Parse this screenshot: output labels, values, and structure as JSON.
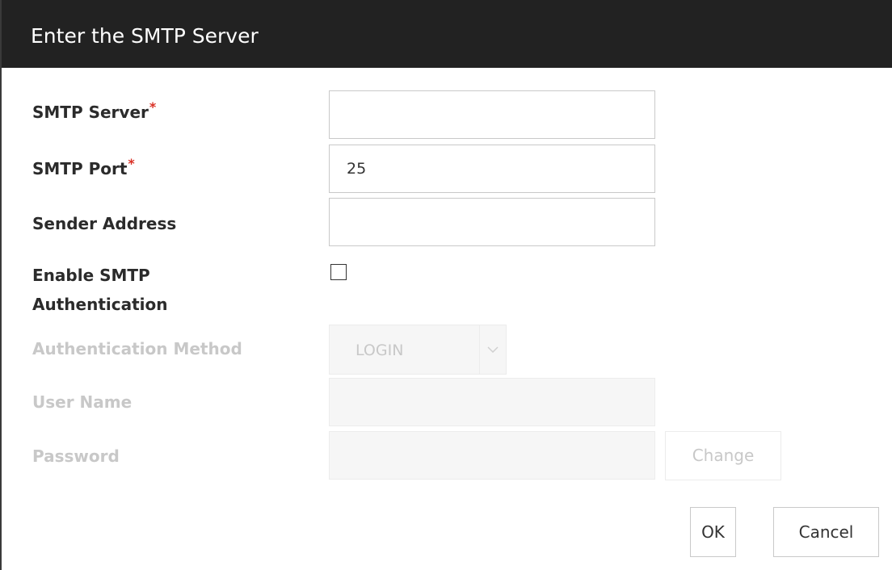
{
  "dialog": {
    "title": "Enter the SMTP Server"
  },
  "form": {
    "smtp_server": {
      "label": "SMTP Server",
      "required_mark": "*",
      "value": ""
    },
    "smtp_port": {
      "label": "SMTP Port",
      "required_mark": "*",
      "value": "25"
    },
    "sender_address": {
      "label": "Sender Address",
      "value": ""
    },
    "enable_auth": {
      "label_line1": "Enable SMTP",
      "label_line2": "Authentication",
      "checked": false
    },
    "auth_method": {
      "label": "Authentication Method",
      "value": "LOGIN",
      "disabled": true
    },
    "user_name": {
      "label": "User Name",
      "value": "",
      "disabled": true
    },
    "password": {
      "label": "Password",
      "value": "",
      "disabled": true,
      "change_label": "Change"
    }
  },
  "buttons": {
    "ok_label": "OK",
    "cancel_label": "Cancel"
  },
  "colors": {
    "titlebar_bg": "#222222",
    "required_mark": "#d93025",
    "disabled_text": "#c8c8c8"
  }
}
